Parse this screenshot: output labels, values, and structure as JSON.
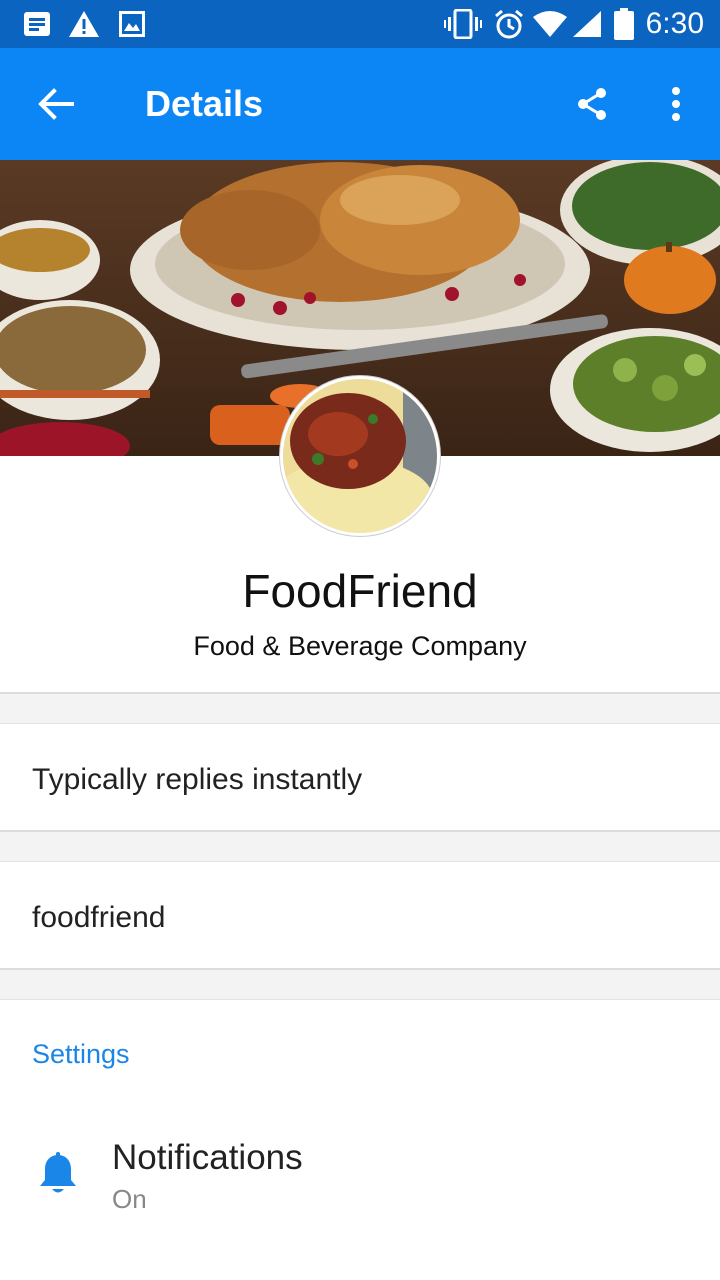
{
  "status_bar": {
    "time": "6:30",
    "icons_left": [
      "message-icon",
      "warning-icon",
      "image-icon"
    ],
    "icons_right": [
      "vibrate-icon",
      "alarm-icon",
      "wifi-icon",
      "signal-icon",
      "battery-icon"
    ]
  },
  "app_bar": {
    "title": "Details",
    "color": "#0d86f5"
  },
  "profile": {
    "name": "FoodFriend",
    "category": "Food & Beverage Company"
  },
  "info": {
    "response_time": "Typically replies instantly",
    "username": "foodfriend"
  },
  "settings": {
    "header": "Settings",
    "notifications": {
      "label": "Notifications",
      "value": "On"
    }
  },
  "colors": {
    "status_bar": "#0b64c0",
    "accent": "#1a86e8"
  }
}
